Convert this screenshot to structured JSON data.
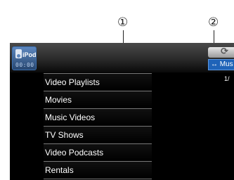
{
  "callouts": [
    "①",
    "②"
  ],
  "source": {
    "label": "iPod",
    "time": "00:00",
    "icon": "ipod-icon"
  },
  "header": {
    "mode_icon": "repeat-icon",
    "music_switch_label": "↔ Mus",
    "page_counter": "1/"
  },
  "category_list": [
    "Video Playlists",
    "Movies",
    "Music Videos",
    "TV Shows",
    "Video Podcasts",
    "Rentals"
  ]
}
